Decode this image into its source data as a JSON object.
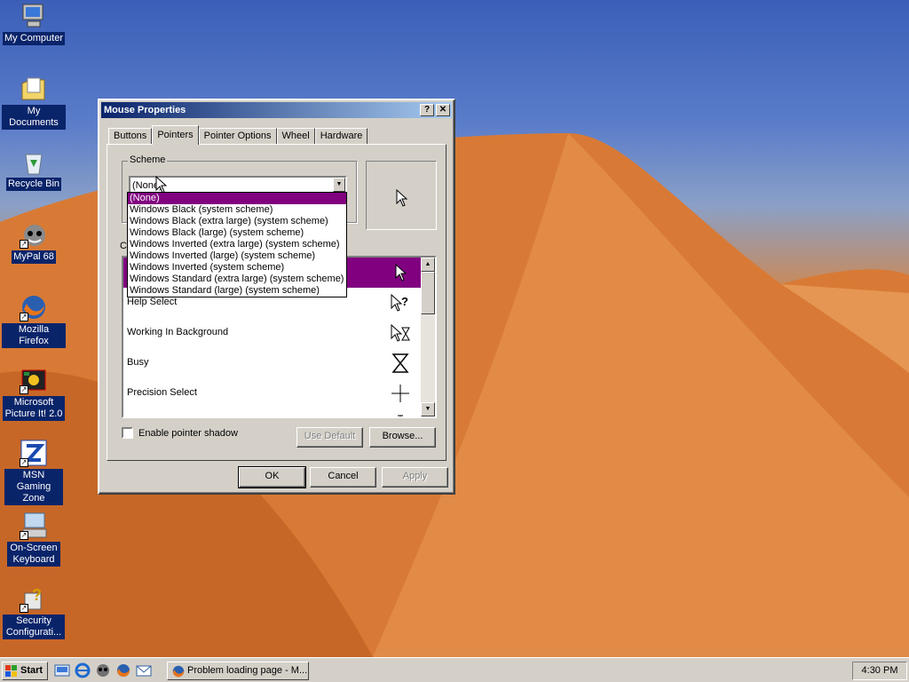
{
  "desktop": {
    "icons": [
      {
        "label": "My Computer",
        "icon": "my-computer-icon"
      },
      {
        "label": "My Documents",
        "icon": "my-documents-icon"
      },
      {
        "label": "Recycle Bin",
        "icon": "recycle-bin-icon"
      },
      {
        "label": "MyPal 68",
        "icon": "mypal-icon"
      },
      {
        "label": "Mozilla Firefox",
        "icon": "firefox-icon"
      },
      {
        "label": "Microsoft Picture It! 2.0",
        "icon": "picture-it-icon"
      },
      {
        "label": "MSN Gaming Zone",
        "icon": "msn-gaming-icon"
      },
      {
        "label": "On-Screen Keyboard",
        "icon": "keyboard-icon"
      },
      {
        "label": "Security Configurati...",
        "icon": "security-config-icon"
      }
    ]
  },
  "dialog": {
    "title": "Mouse Properties",
    "help_label": "?",
    "close_label": "✕",
    "tabs": [
      {
        "label": "Buttons"
      },
      {
        "label": "Pointers"
      },
      {
        "label": "Pointer Options"
      },
      {
        "label": "Wheel"
      },
      {
        "label": "Hardware"
      }
    ],
    "active_tab": "Pointers",
    "scheme_title": "Scheme",
    "scheme_value": "(None)",
    "customize_label": "C",
    "pointer_list": [
      {
        "name": "",
        "icon": "arrow-cursor-icon",
        "selected": true
      },
      {
        "name": "Help Select",
        "icon": "help-select-cursor-icon"
      },
      {
        "name": "Working In Background",
        "icon": "working-background-cursor-icon"
      },
      {
        "name": "Busy",
        "icon": "hourglass-cursor-icon"
      },
      {
        "name": "Precision Select",
        "icon": "crosshair-cursor-icon"
      },
      {
        "name": "",
        "icon": "text-select-cursor-icon"
      }
    ],
    "shadow_label": "Enable pointer shadow",
    "use_default_label": "Use Default",
    "browse_label": "Browse...",
    "ok_label": "OK",
    "cancel_label": "Cancel",
    "apply_label": "Apply",
    "scheme_options": [
      "(None)",
      "Windows Black  (system scheme)",
      "Windows Black (extra large) (system scheme)",
      "Windows Black (large) (system scheme)",
      "Windows Inverted (extra large) (system scheme)",
      "Windows Inverted (large) (system scheme)",
      "Windows Inverted (system scheme)",
      "Windows Standard (extra large) (system scheme)",
      "Windows Standard (large) (system scheme)"
    ]
  },
  "taskbar": {
    "start_label": "Start",
    "task_label": "Problem loading page - M...",
    "clock": "4:30 PM"
  },
  "colors": {
    "selection": "#800080",
    "titlebar": "#0a246a",
    "face": "#d4d0c8"
  }
}
